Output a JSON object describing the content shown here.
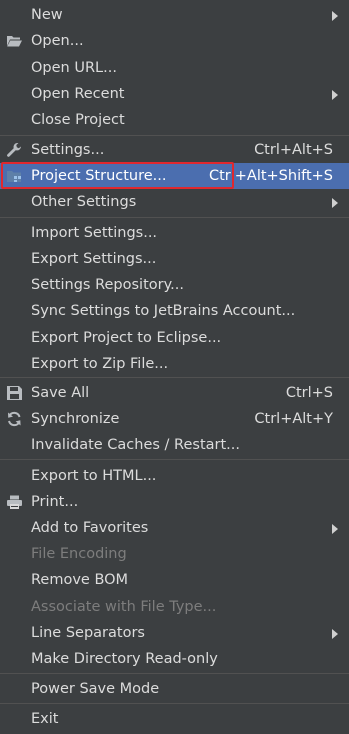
{
  "menu": {
    "new": {
      "label": "New"
    },
    "open": {
      "label": "Open...",
      "icon": "folder-open-icon"
    },
    "open_url": {
      "label": "Open URL..."
    },
    "open_recent": {
      "label": "Open Recent"
    },
    "close_project": {
      "label": "Close Project"
    },
    "settings": {
      "label": "Settings...",
      "shortcut": "Ctrl+Alt+S",
      "icon": "wrench-icon"
    },
    "project_structure": {
      "label": "Project Structure...",
      "shortcut": "Ctrl+Alt+Shift+S",
      "icon": "project-structure-icon",
      "selected": true
    },
    "other_settings": {
      "label": "Other Settings"
    },
    "import_settings": {
      "label": "Import Settings..."
    },
    "export_settings": {
      "label": "Export Settings..."
    },
    "settings_repository": {
      "label": "Settings Repository..."
    },
    "sync_settings": {
      "label": "Sync Settings to JetBrains Account..."
    },
    "export_eclipse": {
      "label": "Export Project to Eclipse..."
    },
    "export_zip": {
      "label": "Export to Zip File..."
    },
    "save_all": {
      "label": "Save All",
      "shortcut": "Ctrl+S",
      "icon": "save-icon"
    },
    "synchronize": {
      "label": "Synchronize",
      "shortcut": "Ctrl+Alt+Y",
      "icon": "sync-icon"
    },
    "invalidate_caches": {
      "label": "Invalidate Caches / Restart..."
    },
    "export_html": {
      "label": "Export to HTML..."
    },
    "print": {
      "label": "Print...",
      "icon": "printer-icon"
    },
    "add_favorites": {
      "label": "Add to Favorites"
    },
    "file_encoding": {
      "label": "File Encoding",
      "disabled": true
    },
    "remove_bom": {
      "label": "Remove BOM"
    },
    "associate_file_type": {
      "label": "Associate with File Type...",
      "disabled": true
    },
    "line_separators": {
      "label": "Line Separators"
    },
    "make_readonly": {
      "label": "Make Directory Read-only"
    },
    "power_save": {
      "label": "Power Save Mode"
    },
    "exit": {
      "label": "Exit"
    }
  },
  "colors": {
    "background": "#3c3f41",
    "selection": "#4b6eaf",
    "text": "#dcdcdc",
    "disabled_text": "#7d7d7d",
    "highlight_border": "#e0282e"
  }
}
